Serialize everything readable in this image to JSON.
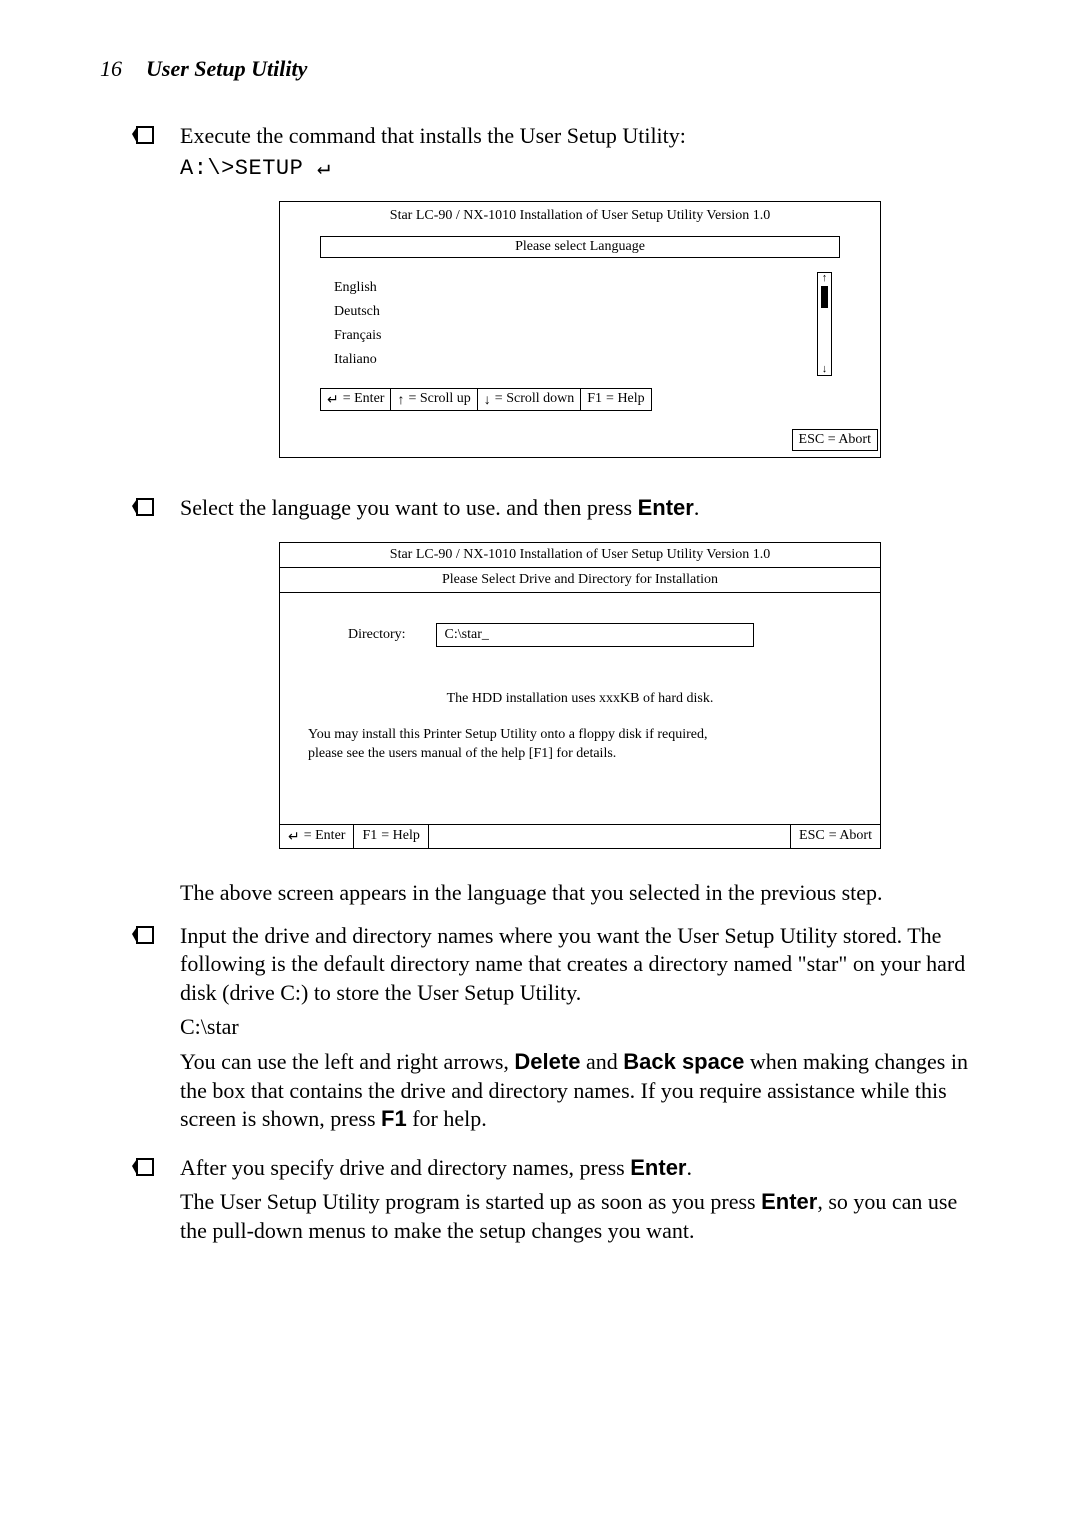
{
  "header": {
    "page_num": "16",
    "title": "User Setup Utility"
  },
  "b1": {
    "text": "Execute the command that installs the User Setup Utility:",
    "cmd": "A:\\>SETUP ↵"
  },
  "screen1": {
    "title": "Star LC-90 / NX-1010 Installation of User Setup Utility Version 1.0",
    "lang_header": "Please select Language",
    "langs": {
      "l0": "English",
      "l1": "Deutsch",
      "l2": "Français",
      "l3": "Italiano"
    },
    "keys": {
      "enter_sym": "↵",
      "enter": " = Enter",
      "up_sym": "↑",
      "up": " = Scroll up",
      "down_sym": "↓",
      "down": " = Scroll down",
      "f1_key": "F1",
      "f1": " = Help"
    },
    "abort_key": "ESC",
    "abort": "  = Abort",
    "sb_up": "↑",
    "sb_down": "↓"
  },
  "b2": {
    "text_a": "Select the language you want to use. and then press ",
    "enter": "Enter",
    "text_b": "."
  },
  "screen2": {
    "title": "Star LC-90 / NX-1010 Installation of User Setup Utility Version 1.0",
    "subtitle": "Please Select Drive and Directory for Installation",
    "dir_label": "Directory:",
    "dir_value": "C:\\star_",
    "info1": "The HDD installation uses xxxKB of hard disk.",
    "info2a": "You may install this Printer Setup Utility onto a floppy disk if required,",
    "info2b": "please see the users manual of the help [F1] for details.",
    "keys": {
      "enter_sym": "↵",
      "enter": " = Enter",
      "f1_key": "F1",
      "f1": " = Help",
      "esc_key": "ESC",
      "esc": "  = Abort"
    }
  },
  "after2": "The above screen appears in the language that you selected in the previous step.",
  "b3": {
    "l1": "Input the drive and directory names where you want the User Setup Utility stored. The following is the default directory name that creates a directory named \"star\" on your hard disk (drive C:) to store the User Setup Utility.",
    "l2": "C:\\star",
    "l3a": "You can use the left and right arrows, ",
    "del": "Delete",
    "l3b": " and ",
    "bsp": "Back space",
    "l3c": " when making changes in the box that contains the drive and directory names. If you require assistance while this screen is shown, press ",
    "f1": "F1",
    "l3d": " for help."
  },
  "b4": {
    "l1a": "After you specify drive and directory names, press ",
    "enter1": "Enter",
    "l1b": ".",
    "l2a": "The User Setup Utility program is started up as soon as you press ",
    "enter2": "Enter",
    "l2b": ", so you can use the pull-down menus to make the setup changes you want."
  }
}
